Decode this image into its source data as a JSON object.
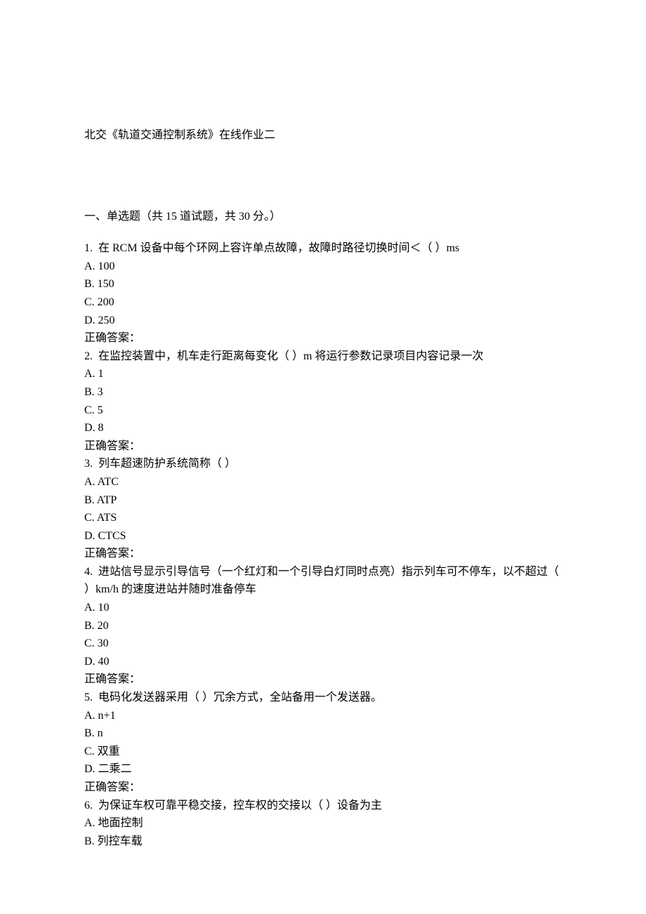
{
  "title": "北交《轨道交通控制系统》在线作业二",
  "section_header": "一、单选题（共 15 道试题，共 30 分。）",
  "questions": [
    {
      "num": "1.",
      "text": "  在 RCM 设备中每个环网上容许单点故障，故障时路径切换时间＜（ ）ms",
      "options": [
        "A. 100",
        "B. 150",
        "C. 200",
        "D. 250"
      ],
      "answer_label": "正确答案："
    },
    {
      "num": "2.",
      "text": "  在监控装置中，机车走行距离每变化（ ）m 将运行参数记录项目内容记录一次",
      "options": [
        "A. 1",
        "B. 3",
        "C. 5",
        "D. 8"
      ],
      "answer_label": "正确答案："
    },
    {
      "num": "3.",
      "text": "  列车超速防护系统简称（ ）",
      "options": [
        "A. ATC",
        "B. ATP",
        "C. ATS",
        "D. CTCS"
      ],
      "answer_label": "正确答案："
    },
    {
      "num": "4.",
      "text": "  进站信号显示引导信号（一个红灯和一个引导白灯同时点亮）指示列车可不停车，以不超过（ ）km/h 的速度进站并随时准备停车",
      "options": [
        "A. 10",
        "B. 20",
        "C. 30",
        "D. 40"
      ],
      "answer_label": "正确答案："
    },
    {
      "num": "5.",
      "text": "  电码化发送器采用（ ）冗余方式，全站备用一个发送器。",
      "options": [
        "A. n+1",
        "B. n",
        "C. 双重",
        "D. 二乘二"
      ],
      "answer_label": "正确答案："
    },
    {
      "num": "6.",
      "text": "  为保证车权可靠平稳交接，控车权的交接以（ ）设备为主",
      "options": [
        "A. 地面控制",
        "B. 列控车载"
      ],
      "answer_label": ""
    }
  ]
}
